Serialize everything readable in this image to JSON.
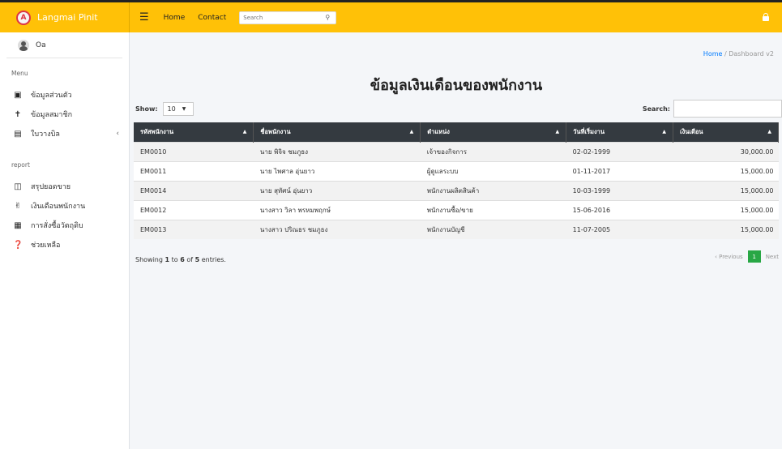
{
  "brand": {
    "logo_letter": "A",
    "name": "Langmai Pinit"
  },
  "nav": {
    "menu_icon": "menu-icon",
    "home": "Home",
    "contact": "Contact",
    "search_placeholder": "Search",
    "lock_icon": "lock-icon"
  },
  "sidebar": {
    "user": "Oa",
    "menu_label": "Menu",
    "menu_items": [
      {
        "label": "ข้อมูลส่วนตัว",
        "icon": "id-card-icon"
      },
      {
        "label": "ข้อมูลสมาชิก",
        "icon": "person-icon"
      },
      {
        "label": "ใบวางบิล",
        "icon": "file-icon"
      }
    ],
    "report_label": "report",
    "report_items": [
      {
        "label": "สรุปยอดขาย",
        "icon": "money-bill-icon"
      },
      {
        "label": "เงินเดือนพนักงาน",
        "icon": "hand-money-icon"
      },
      {
        "label": "การสั่งซื้อวัตถุดิบ",
        "icon": "grid-icon"
      },
      {
        "label": "ช่วยเหลือ",
        "icon": "question-circle-icon"
      }
    ]
  },
  "breadcrumb": {
    "home": "Home",
    "separator": "/",
    "current": "Dashboard v2"
  },
  "page_title": "ข้อมูลเงินเดือนของพนักงาน",
  "table_controls": {
    "show_label": "Show:",
    "show_value": "10",
    "search_label": "Search:"
  },
  "table": {
    "headers": [
      "รหัสพนักงาน",
      "ชื่อพนักงาน",
      "ตำแหน่ง",
      "วันที่เริ่มงาน",
      "เงินเดือน"
    ],
    "rows": [
      [
        "EM0010",
        "นาย พิจิจ ชมภูธง",
        "เจ้าของกิจการ",
        "02-02-1999",
        "30,000.00"
      ],
      [
        "EM0011",
        "นาย ไพศาล อุ่นยาว",
        "ผู้ดูแลระบบ",
        "01-11-2017",
        "15,000.00"
      ],
      [
        "EM0014",
        "นาย สุทัศน์ อุ่นยาว",
        "พนักงานผลิตสินค้า",
        "10-03-1999",
        "15,000.00"
      ],
      [
        "EM0012",
        "นางสาว วิลา พรหมพฤกษ์",
        "พนักงานซื้อ/ขาย",
        "15-06-2016",
        "15,000.00"
      ],
      [
        "EM0013",
        "นางสาว ปริณธร ชมภูธง",
        "พนักงานบัญชี",
        "11-07-2005",
        "15,000.00"
      ]
    ]
  },
  "footer": {
    "showing_prefix": "Showing ",
    "from": "1",
    "to_word": " to ",
    "to": "6",
    "of_word": " of ",
    "total": "5",
    "suffix": " entries.",
    "prev": "Previous",
    "current_page": "1",
    "next": "Next"
  },
  "colors": {
    "topbar": "#ffc107",
    "table_header": "#343a40",
    "pager_active": "#28a745",
    "link": "#007bff"
  }
}
